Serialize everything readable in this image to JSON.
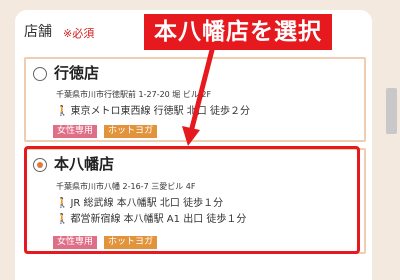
{
  "form": {
    "section_label": "店舗",
    "required_mark": "※必須"
  },
  "callout": {
    "text": "本八幡店を選択"
  },
  "stores": [
    {
      "name": "行徳店",
      "selected": false,
      "address": "千葉県市川市行徳駅前 1-27-20 堀  ビル 2F",
      "access": [
        "東京メトロ東西線 行徳駅 北口 徒歩２分"
      ],
      "tags": [
        "女性専用",
        "ホットヨガ"
      ]
    },
    {
      "name": "本八幡店",
      "selected": true,
      "address": "千葉県市川市八幡 2-16-7 三愛ビル 4F",
      "access": [
        "JR 総武線 本八幡駅 北口 徒歩１分",
        "都営新宿線 本八幡駅 A1 出口 徒歩１分"
      ],
      "tags": [
        "女性専用",
        "ホットヨガ"
      ]
    }
  ],
  "colors": {
    "accent_red": "#e5191e",
    "tag_pink": "#df6f87",
    "tag_orange": "#e2943c",
    "card_border": "#efcdb0"
  }
}
